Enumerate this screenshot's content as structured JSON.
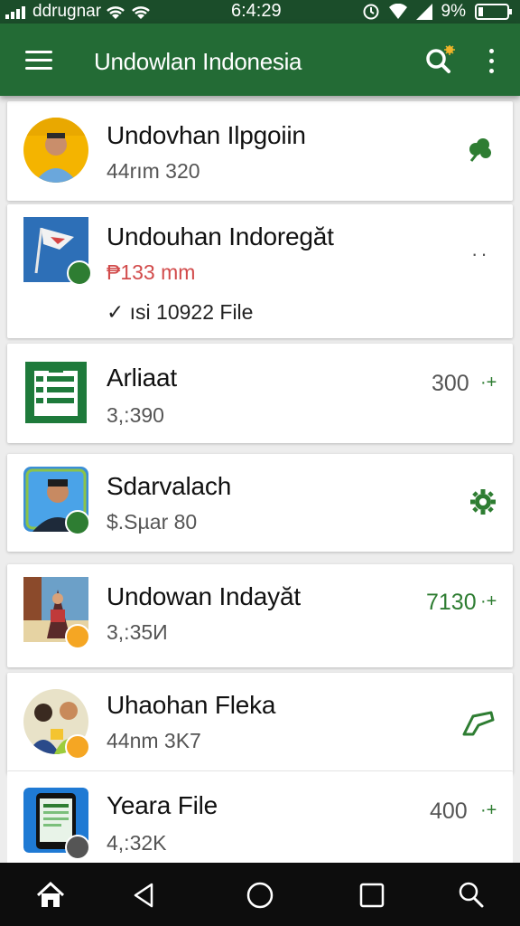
{
  "status_bar": {
    "carrier": "ddrugnar",
    "time": "6:4:29",
    "battery": "9%"
  },
  "app_bar": {
    "title": "Undowlan Indonesia"
  },
  "items": [
    {
      "title": "Undovhan Ilpgoiin",
      "subtitle": "44rım 320",
      "right": ""
    },
    {
      "title": "Undouhan Indoregăt",
      "subtitle": "₱133 mm",
      "detail": "✓ ısi 10922 File",
      "right": "··"
    },
    {
      "title": "Arliaat",
      "subtitle": "3,:390",
      "right": "300",
      "right_suffix": "·+"
    },
    {
      "title": "Sdarvalach",
      "subtitle": "$.Sµar 80",
      "right": ""
    },
    {
      "title": "Undowan Indayăt",
      "subtitle": "3,:35И",
      "right": "7130",
      "right_suffix": "·+"
    },
    {
      "title": "Uhaohan Fleka",
      "subtitle": "44nm 3K7",
      "right": ""
    },
    {
      "title": "Yeara File",
      "subtitle": "4,:32K",
      "right": "400",
      "right_suffix": "·+"
    }
  ],
  "colors": {
    "status_bar": "#1b4d2a",
    "app_bar": "#236b35",
    "accent_green": "#2e7d32",
    "badge_orange": "#f5a623",
    "nav_bar": "#0d0d0d"
  }
}
